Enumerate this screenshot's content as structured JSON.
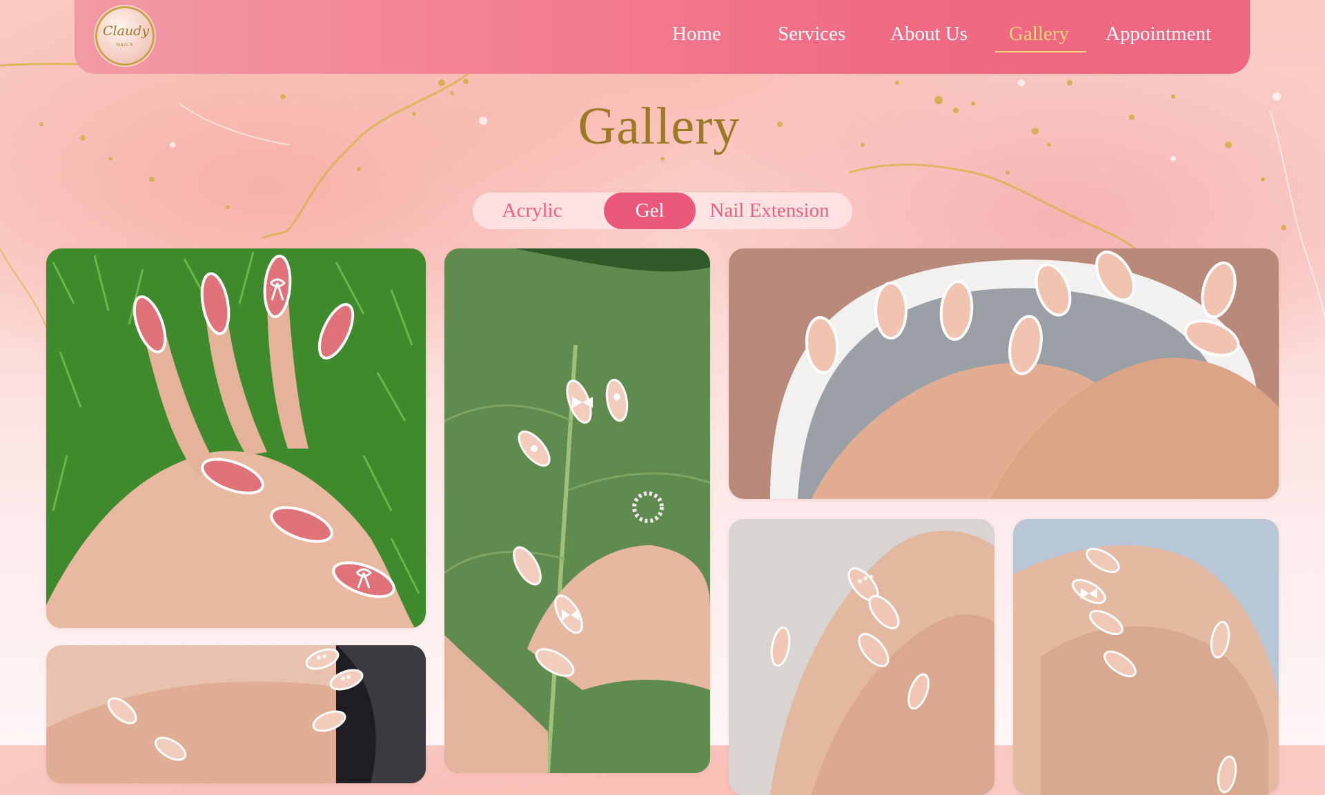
{
  "brand": {
    "logo_text": "Claudy",
    "logo_subtext": "NAILS"
  },
  "nav": {
    "items": [
      {
        "label": "Home"
      },
      {
        "label": "Services"
      },
      {
        "label": "About Us"
      },
      {
        "label": "Gallery",
        "active": true
      },
      {
        "label": "Appointment"
      }
    ]
  },
  "page": {
    "title": "Gallery"
  },
  "tabs": {
    "items": [
      {
        "label": "Acrylic"
      },
      {
        "label": "Gel",
        "active": true
      },
      {
        "label": "Nail Extension"
      }
    ]
  },
  "gallery": {
    "photos": [
      {
        "subject": "almond gel nails with white bows on grass"
      },
      {
        "subject": "nude nails with bows on green leaf"
      },
      {
        "subject": "french tip almond nails on nail lamp"
      },
      {
        "subject": "clear nails with white french tips and pearls"
      },
      {
        "subject": "nude nails with white tips and bow on blue towel"
      },
      {
        "subject": "pearl decorated nails on nail lamp"
      }
    ]
  },
  "colors": {
    "nav_bg": "#f06a84",
    "accent_gold": "#9b7a26",
    "active_nav": "#f6d97a",
    "tab_active": "#ec587a",
    "tab_text": "#ee5f7f"
  }
}
